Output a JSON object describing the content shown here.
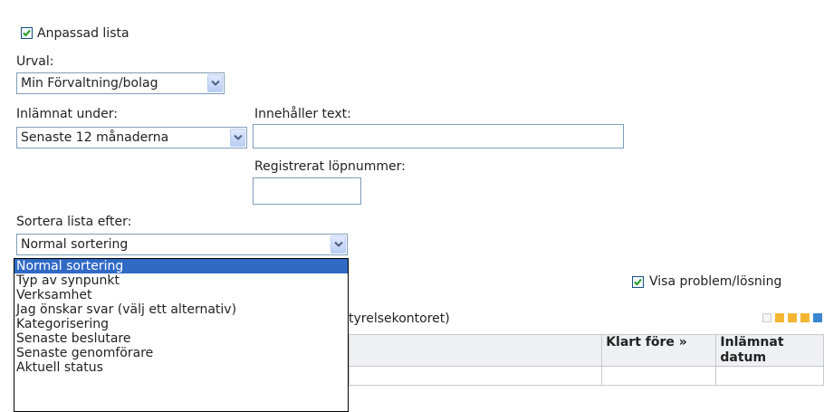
{
  "filters": {
    "custom_list_label": "Anpassad lista",
    "custom_list_checked": true,
    "selection_label": "Urval:",
    "selection_value": "Min Förvaltning/bolag",
    "submitted_label": "Inlämnat under:",
    "submitted_value": "Senaste 12 månaderna",
    "contains_text_label": "Innehåller text:",
    "contains_text_value": "",
    "serial_label": "Registrerat löpnummer:",
    "serial_value": ""
  },
  "sort": {
    "label": "Sortera lista efter:",
    "value": "Normal sortering",
    "options": [
      "Normal sortering",
      "Typ av synpunkt",
      "Verksamhet",
      "Jag önskar svar (välj ett alternativ)",
      "Kategorisering",
      "Senaste beslutare",
      "Senaste genomförare",
      "Aktuell status"
    ],
    "selected_index": 0
  },
  "show_problem": {
    "label": "Visa problem/lösning",
    "checked": true
  },
  "list_heading_fragment": "tyrelsekontoret)",
  "table": {
    "headers": [
      "Klart före »",
      "Inlämnat datum"
    ]
  },
  "colors": {
    "selection_highlight": "#316ac5",
    "pager_orange": "#f2b632",
    "pager_blue": "#3b86d1"
  }
}
